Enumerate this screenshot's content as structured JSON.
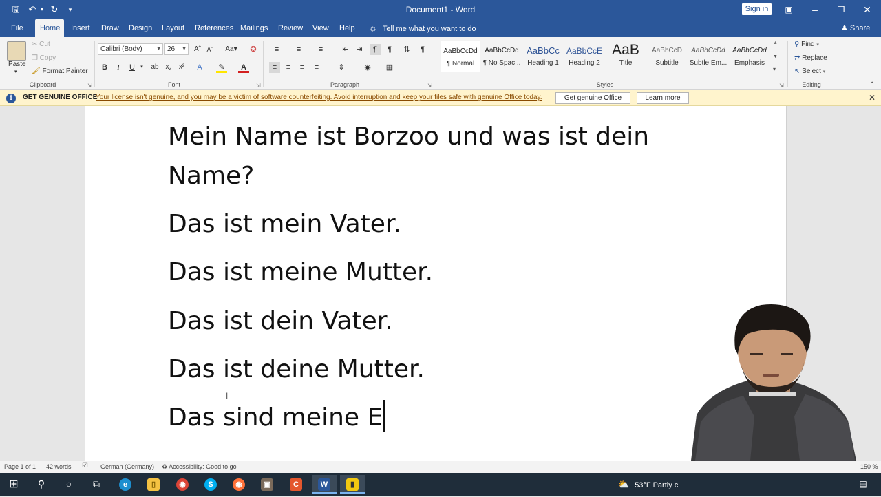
{
  "titlebar": {
    "title": "Document1 - Word",
    "sign_in": "Sign in",
    "save_icon": "save-icon",
    "undo_icon": "undo-icon",
    "redo_icon": "redo-icon"
  },
  "tabs": {
    "items": [
      "File",
      "Home",
      "Insert",
      "Draw",
      "Design",
      "Layout",
      "References",
      "Mailings",
      "Review",
      "View",
      "Help"
    ],
    "active": "Home",
    "tell_me": "Tell me what you want to do",
    "share": "Share"
  },
  "ribbon": {
    "clipboard": {
      "paste": "Paste",
      "cut": "Cut",
      "copy": "Copy",
      "format_painter": "Format Painter",
      "label": "Clipboard"
    },
    "font": {
      "name": "Calibri (Body)",
      "size": "26",
      "label": "Font"
    },
    "paragraph": {
      "label": "Paragraph"
    },
    "styles": {
      "items": [
        {
          "preview": "AaBbCcDd",
          "name": "¶ Normal"
        },
        {
          "preview": "AaBbCcDd",
          "name": "¶ No Spac..."
        },
        {
          "preview": "AaBbCc",
          "name": "Heading 1"
        },
        {
          "preview": "AaBbCcE",
          "name": "Heading 2"
        },
        {
          "preview": "AaB",
          "name": "Title"
        },
        {
          "preview": "AaBbCcD",
          "name": "Subtitle"
        },
        {
          "preview": "AaBbCcDd",
          "name": "Subtle Em..."
        },
        {
          "preview": "AaBbCcDd",
          "name": "Emphasis"
        }
      ],
      "label": "Styles"
    },
    "editing": {
      "find": "Find",
      "replace": "Replace",
      "select": "Select",
      "label": "Editing"
    }
  },
  "infobar": {
    "title": "GET GENUINE OFFICE",
    "message": "Your license isn't genuine, and you may be a victim of software counterfeiting. Avoid interruption and keep your files safe with genuine Office today.",
    "btn_genuine": "Get genuine Office",
    "btn_learn": "Learn more"
  },
  "document": {
    "line1": "Mein Name ist Borzoo und was ist dein",
    "line2": "Name?",
    "line3": "Das ist mein Vater.",
    "line4": "Das ist meine Mutter.",
    "line5": "Das ist dein Vater.",
    "line6": "Das ist deine Mutter.",
    "line7": "Das sind meine E"
  },
  "status": {
    "page": "Page 1 of 1",
    "words": "42 words",
    "language": "German (Germany)",
    "accessibility": "Accessibility: Good to go",
    "zoom": "150 %"
  },
  "taskbar": {
    "weather": "53°F  Partly c"
  },
  "colors": {
    "word_blue": "#2b579a",
    "infobar_bg": "#fff4cd",
    "taskbar_bg": "#1f2d3a"
  }
}
